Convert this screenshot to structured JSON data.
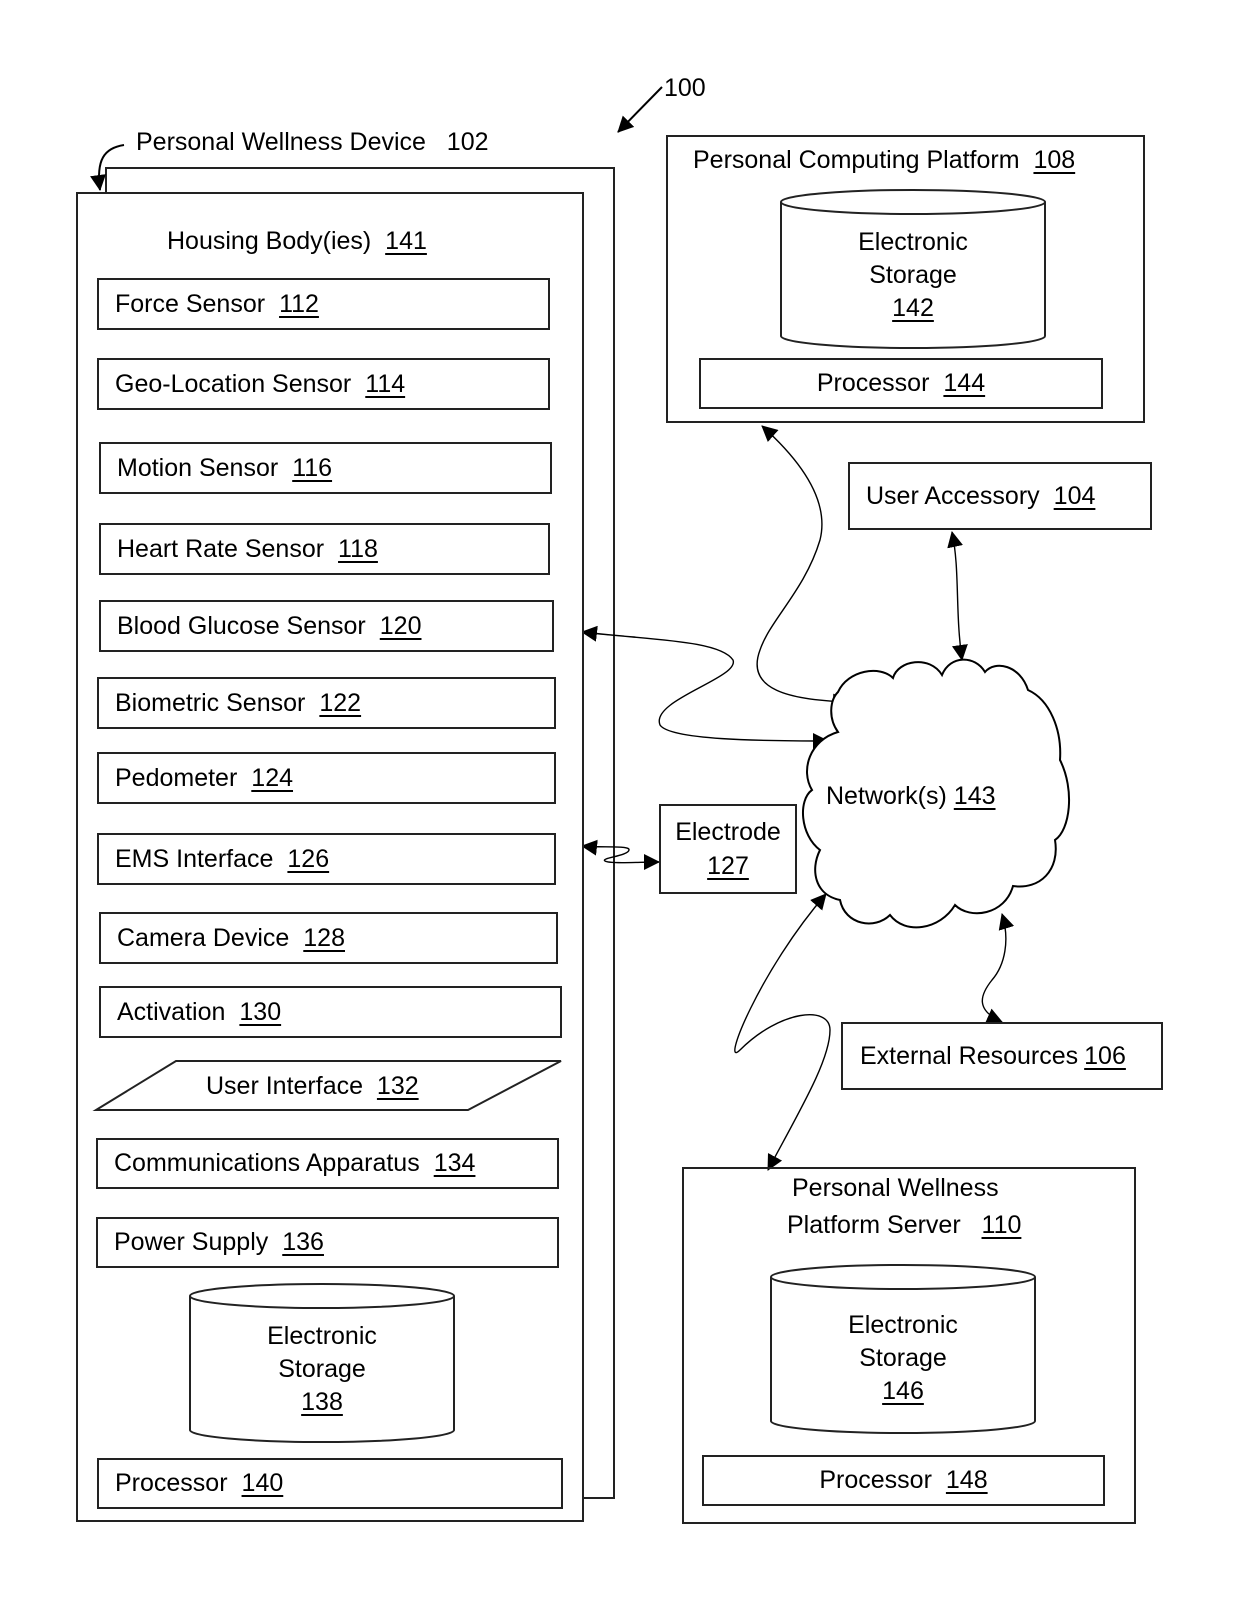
{
  "figure": {
    "ref": "100"
  },
  "device": {
    "title": "Personal Wellness Device",
    "title_num": "102",
    "housing": "Housing Body(ies)",
    "housing_num": "141",
    "components": [
      {
        "label": "Force Sensor",
        "num": "112"
      },
      {
        "label": "Geo-Location Sensor",
        "num": "114"
      },
      {
        "label": "Motion Sensor",
        "num": "116"
      },
      {
        "label": "Heart Rate Sensor",
        "num": "118"
      },
      {
        "label": "Blood Glucose Sensor",
        "num": "120"
      },
      {
        "label": "Biometric Sensor",
        "num": "122"
      },
      {
        "label": "Pedometer",
        "num": "124"
      },
      {
        "label": "EMS Interface",
        "num": "126"
      },
      {
        "label": "Camera Device",
        "num": "128"
      },
      {
        "label": "Activation",
        "num": "130"
      },
      {
        "label": "User Interface",
        "num": "132"
      },
      {
        "label": "Communications Apparatus",
        "num": "134"
      },
      {
        "label": "Power Supply",
        "num": "136"
      }
    ],
    "storage": {
      "line1": "Electronic",
      "line2": "Storage",
      "num": "138"
    },
    "processor": {
      "label": "Processor",
      "num": "140"
    }
  },
  "pcp": {
    "title": "Personal Computing Platform",
    "title_num": "108",
    "storage": {
      "line1": "Electronic",
      "line2": "Storage",
      "num": "142"
    },
    "processor": {
      "label": "Processor",
      "num": "144"
    }
  },
  "accessory": {
    "label": "User Accessory",
    "num": "104"
  },
  "network": {
    "label": "Network(s)",
    "num": "143"
  },
  "electrode": {
    "label": "Electrode",
    "num": "127"
  },
  "external": {
    "label": "External Resources",
    "num": "106"
  },
  "server": {
    "title1": "Personal Wellness",
    "title2": "Platform Server",
    "title_num": "110",
    "storage": {
      "line1": "Electronic",
      "line2": "Storage",
      "num": "146"
    },
    "processor": {
      "label": "Processor",
      "num": "148"
    }
  }
}
